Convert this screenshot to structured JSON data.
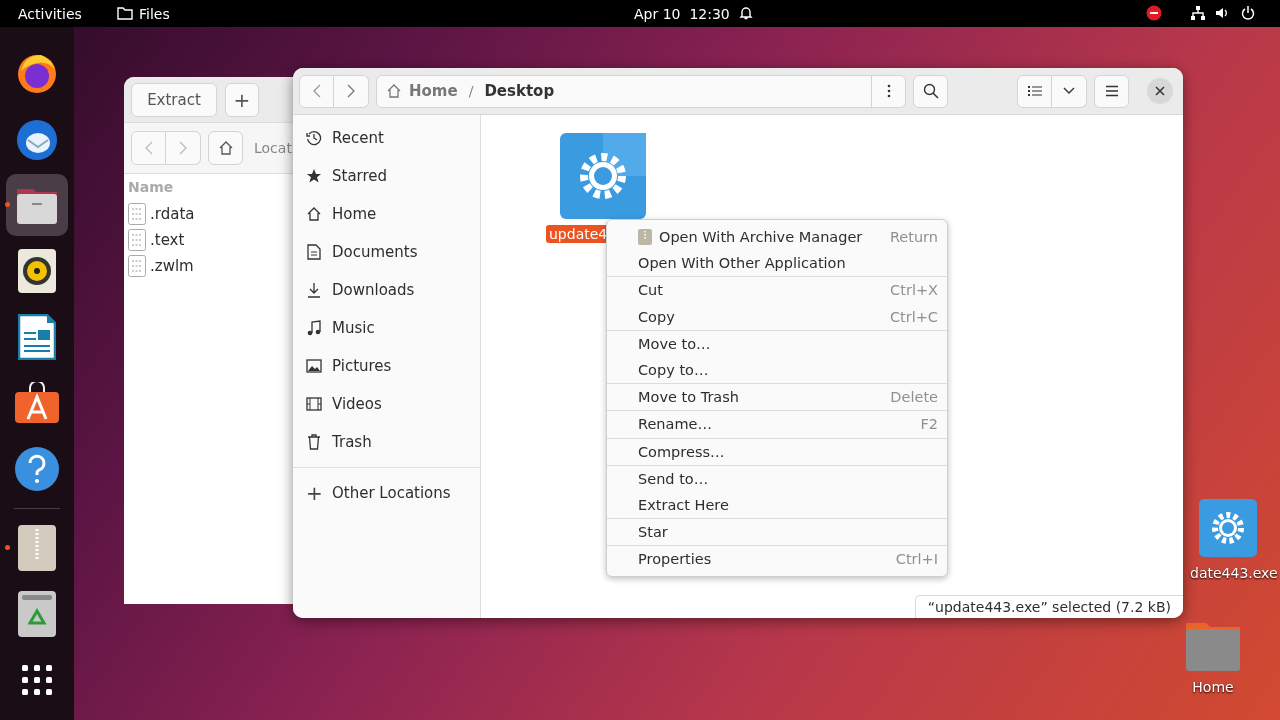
{
  "top_bar": {
    "activities": "Activities",
    "app": "Files",
    "clock": "Apr 10  12:30"
  },
  "dock": {
    "items": [
      {
        "kind": "firefox",
        "running": false,
        "selected": false
      },
      {
        "kind": "thunderbird",
        "running": false,
        "selected": false
      },
      {
        "kind": "files",
        "running": true,
        "selected": true
      },
      {
        "kind": "rhythmbox",
        "running": false,
        "selected": false
      },
      {
        "kind": "writer",
        "running": false,
        "selected": false
      },
      {
        "kind": "store",
        "running": false,
        "selected": false
      },
      {
        "kind": "help",
        "running": false,
        "selected": false
      },
      {
        "kind": "archive",
        "running": true,
        "selected": false
      },
      {
        "kind": "trash",
        "running": false,
        "selected": false
      },
      {
        "kind": "apps",
        "running": false,
        "selected": false
      }
    ]
  },
  "archive_window": {
    "toolbar": [
      "Extract",
      "+"
    ],
    "location": "Locat",
    "column": "Name",
    "files": [
      ".rdata",
      ".text",
      ".zwlm"
    ]
  },
  "files_window": {
    "path": [
      "Home",
      "Desktop"
    ],
    "path_separator": "/",
    "sidebar": [
      {
        "label": "Recent",
        "kind": "recent",
        "selected": false
      },
      {
        "label": "Starred",
        "kind": "star",
        "selected": false
      },
      {
        "label": "Home",
        "kind": "home",
        "selected": false
      },
      {
        "label": "Documents",
        "kind": "document",
        "selected": false
      },
      {
        "label": "Downloads",
        "kind": "download",
        "selected": false
      },
      {
        "label": "Music",
        "kind": "music",
        "selected": false
      },
      {
        "label": "Pictures",
        "kind": "picture",
        "selected": false
      },
      {
        "label": "Videos",
        "kind": "video",
        "selected": false
      },
      {
        "label": "Trash",
        "kind": "trash",
        "selected": false
      }
    ],
    "other_locations": {
      "label": "Other Locations",
      "icon": "+"
    },
    "file": {
      "name": "update4",
      "selected": true
    },
    "context_menu": [
      [
        {
          "label": "Open With Archive Manager",
          "shortcut": "Return",
          "kind": "app"
        },
        {
          "label": "Open With Other Application"
        }
      ],
      [
        {
          "label": "Cut",
          "shortcut": "Ctrl+X"
        },
        {
          "label": "Copy",
          "shortcut": "Ctrl+C"
        }
      ],
      [
        {
          "label": "Move to…"
        },
        {
          "label": "Copy to…"
        }
      ],
      [
        {
          "label": "Move to Trash",
          "shortcut": "Delete"
        }
      ],
      [
        {
          "label": "Rename…",
          "shortcut": "F2"
        }
      ],
      [
        {
          "label": "Compress…"
        }
      ],
      [
        {
          "label": "Send to…"
        },
        {
          "label": "Extract Here"
        }
      ],
      [
        {
          "label": "Star"
        }
      ],
      [
        {
          "label": "Properties",
          "shortcut": "Ctrl+I"
        }
      ]
    ],
    "status": "“update443.exe” selected (7.2 kB)"
  },
  "desktop": [
    {
      "name": "date443.exe",
      "kind": "exe"
    },
    {
      "name": "Home",
      "kind": "folder"
    }
  ]
}
